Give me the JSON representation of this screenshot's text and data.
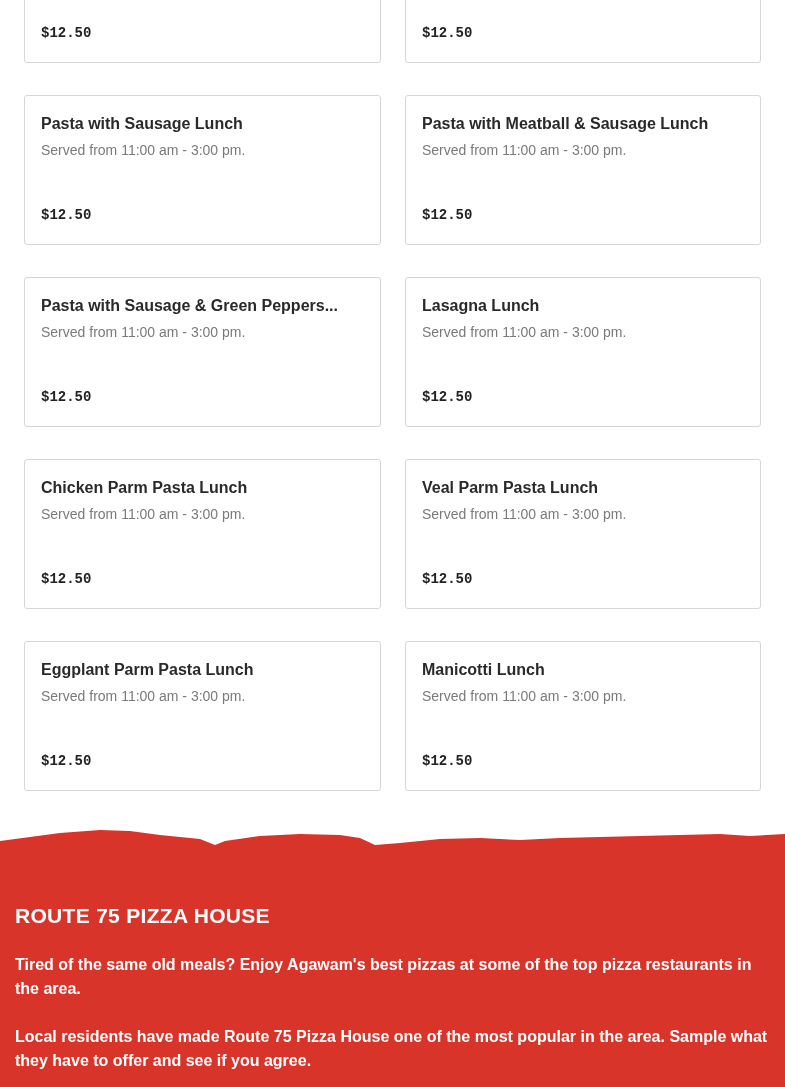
{
  "menu_items": [
    {
      "price": "$12.50"
    },
    {
      "price": "$12.50"
    },
    {
      "name": "Pasta with Sausage Lunch",
      "description": "Served from 11:00 am - 3:00 pm.",
      "price": "$12.50"
    },
    {
      "name": "Pasta with Meatball & Sausage Lunch",
      "description": "Served from 11:00 am - 3:00 pm.",
      "price": "$12.50"
    },
    {
      "name": "Pasta with Sausage & Green Peppers...",
      "description": "Served from 11:00 am - 3:00 pm.",
      "price": "$12.50"
    },
    {
      "name": "Lasagna Lunch",
      "description": "Served from 11:00 am - 3:00 pm.",
      "price": "$12.50"
    },
    {
      "name": "Chicken Parm Pasta Lunch",
      "description": "Served from 11:00 am - 3:00 pm.",
      "price": "$12.50"
    },
    {
      "name": "Veal Parm Pasta Lunch",
      "description": "Served from 11:00 am - 3:00 pm.",
      "price": "$12.50"
    },
    {
      "name": "Eggplant Parm Pasta Lunch",
      "description": "Served from 11:00 am - 3:00 pm.",
      "price": "$12.50"
    },
    {
      "name": "Manicotti Lunch",
      "description": "Served from 11:00 am - 3:00 pm.",
      "price": "$12.50"
    }
  ],
  "footer": {
    "title": "ROUTE 75 PIZZA HOUSE",
    "paragraphs": [
      "Tired of the same old meals? Enjoy Agawam's best pizzas at some of the top pizza restaurants in the area.",
      "Local residents have made Route 75 Pizza House one of the most popular in the area. Sample what they have to offer and see if you agree."
    ]
  }
}
